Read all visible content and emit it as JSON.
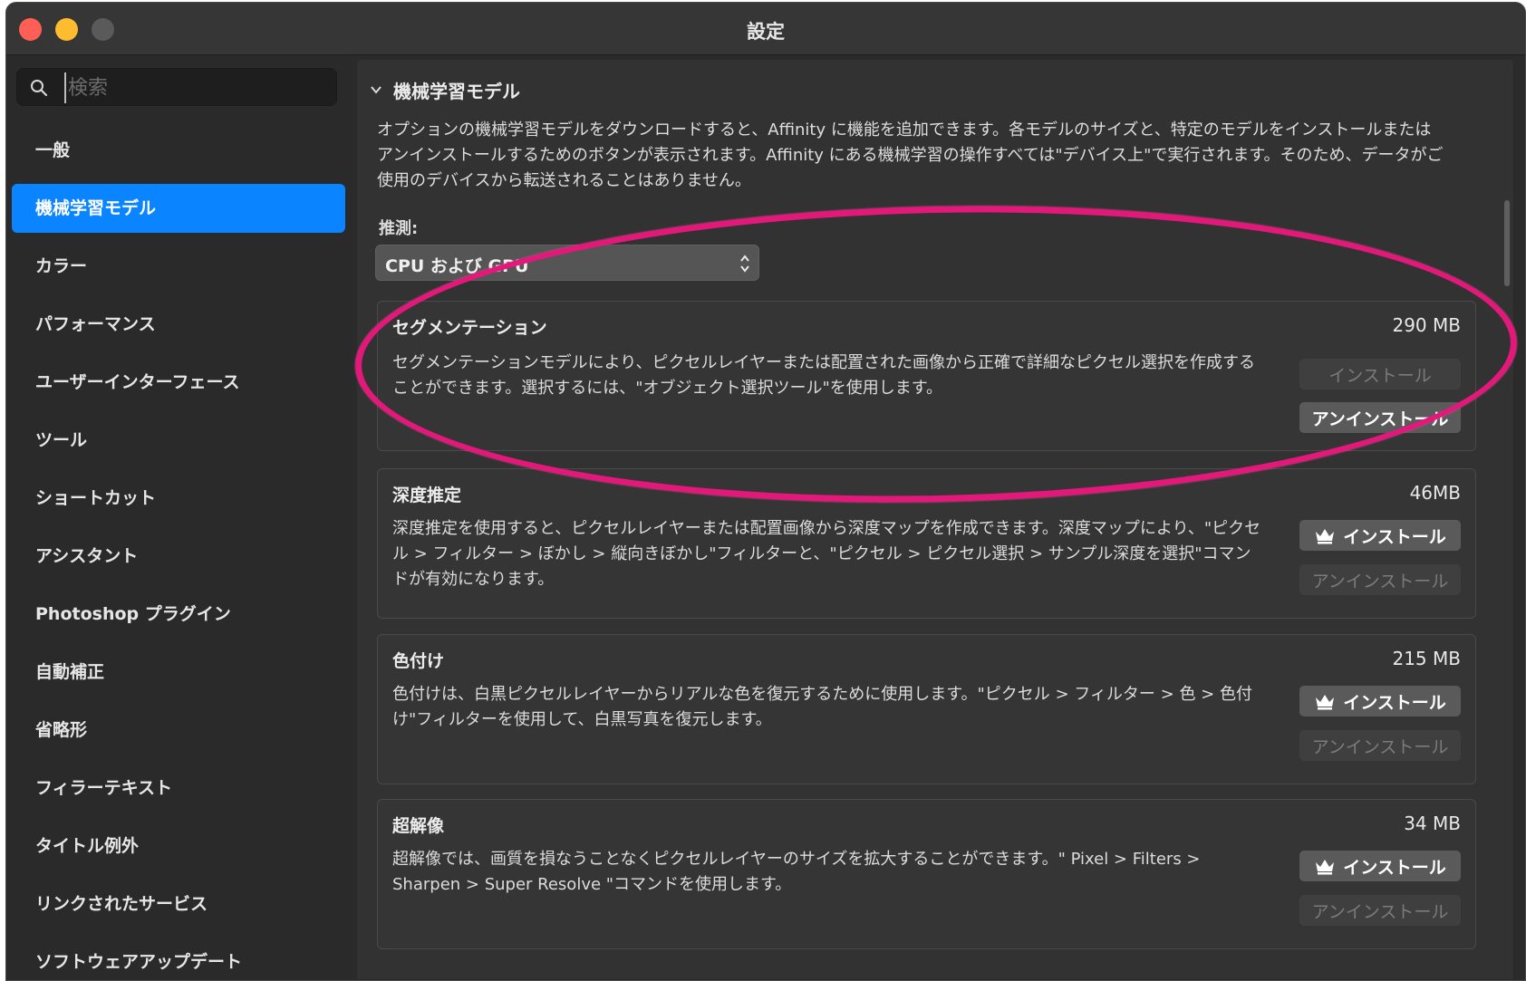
{
  "window": {
    "title": "設定"
  },
  "search": {
    "placeholder": "検索"
  },
  "sidebar": {
    "items": [
      {
        "label": "一般"
      },
      {
        "label": "機械学習モデル",
        "active": true
      },
      {
        "label": "カラー"
      },
      {
        "label": "パフォーマンス"
      },
      {
        "label": "ユーザーインターフェース"
      },
      {
        "label": "ツール"
      },
      {
        "label": "ショートカット"
      },
      {
        "label": "アシスタント"
      },
      {
        "label": "Photoshop プラグイン"
      },
      {
        "label": "自動補正"
      },
      {
        "label": "省略形"
      },
      {
        "label": "フィラーテキスト"
      },
      {
        "label": "タイトル例外"
      },
      {
        "label": "リンクされたサービス"
      },
      {
        "label": "ソフトウェアアップデート"
      }
    ]
  },
  "section": {
    "title": "機械学習モデル",
    "intro": "オプションの機械学習モデルをダウンロードすると、Affinity に機能を追加できます。各モデルのサイズと、特定のモデルをインストールまたはアンインストールするためのボタンが表示されます。Affinity にある機械学習の操作すべては\"デバイス上\"で実行されます。そのため、データがご使用のデバイスから転送されることはありません。",
    "inference_label": "推測:",
    "inference_value": "CPU および GPU"
  },
  "models": [
    {
      "name": "セグメンテーション",
      "size": "290 MB",
      "description": "セグメンテーションモデルにより、ピクセルレイヤーまたは配置された画像から正確で詳細なピクセル選択を作成することができます。選択するには、\"オブジェクト選択ツール\"を使用します。",
      "install_label": "インストール",
      "uninstall_label": "アンインストール"
    },
    {
      "name": "深度推定",
      "size": "46MB",
      "description": "深度推定を使用すると、ピクセルレイヤーまたは配置画像から深度マップを作成できます。深度マップにより、\"ピクセル > フィルター > ぼかし > 縦向きぼかし\"フィルターと、\"ピクセル > ピクセル選択 > サンプル深度を選択\"コマンドが有効になります。",
      "install_label": "インストール",
      "uninstall_label": "アンインストール"
    },
    {
      "name": "色付け",
      "size": "215 MB",
      "description": "色付けは、白黒ピクセルレイヤーからリアルな色を復元するために使用します。\"ピクセル > フィルター > 色 > 色付け\"フィルターを使用して、白黒写真を復元します。",
      "install_label": "インストール",
      "uninstall_label": "アンインストール"
    },
    {
      "name": "超解像",
      "size": "34 MB",
      "description": "超解像では、画質を損なうことなくピクセルレイヤーのサイズを拡大することができます。\" Pixel > Filters > Sharpen > Super Resolve \"コマンドを使用します。",
      "install_label": "インストール",
      "uninstall_label": "アンインストール"
    }
  ],
  "colors": {
    "accent": "#0b84ff",
    "highlight": "#e2197a",
    "close": "#ff5f57",
    "minimize": "#febc2e"
  },
  "icons": {
    "search": "search-icon",
    "chevron": "chevron-down-icon",
    "crown": "crown-icon",
    "select": "up-down-arrows-icon"
  }
}
